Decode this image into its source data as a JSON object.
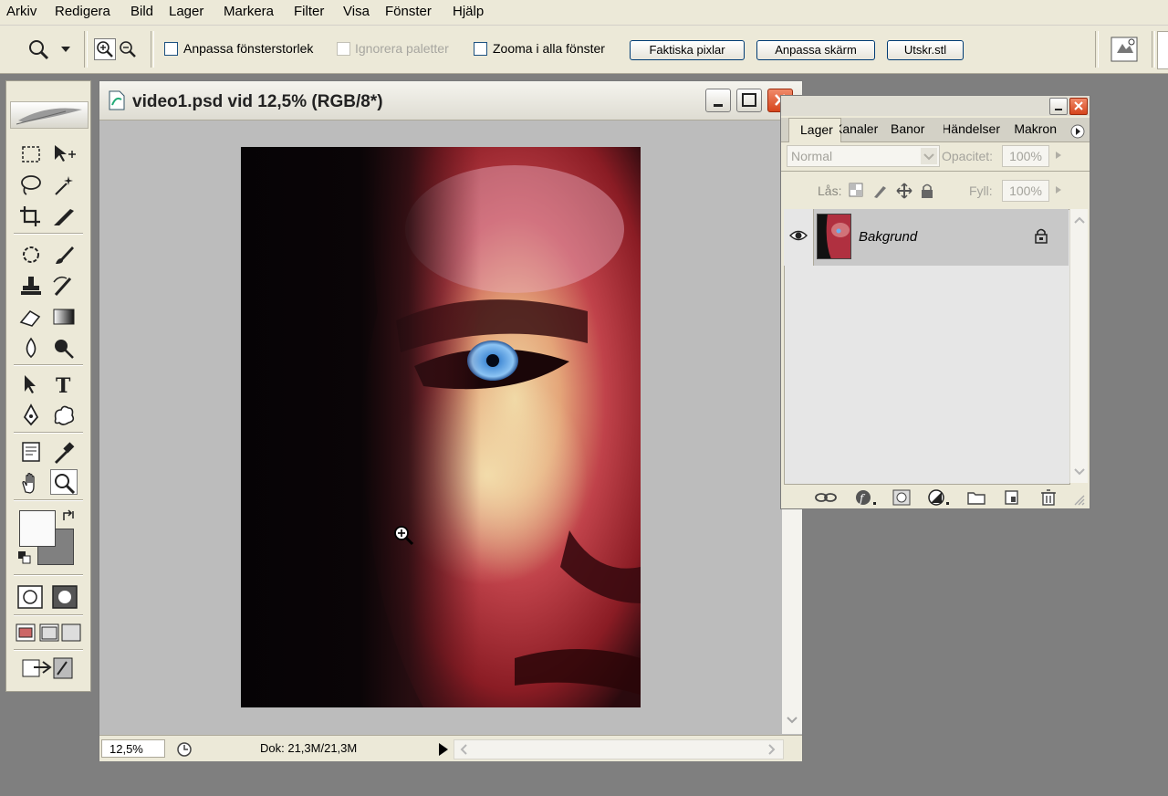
{
  "menu": [
    "Arkiv",
    "Redigera",
    "Bild",
    "Lager",
    "Markera",
    "Filter",
    "Visa",
    "Fönster",
    "Hjälp"
  ],
  "options": {
    "resize_windows_label": "Anpassa fönsterstorlek",
    "ignore_palettes_label": "Ignorera paletter",
    "zoom_all_label": "Zooma i alla fönster",
    "actual_pixels_label": "Faktiska pixlar",
    "fit_screen_label": "Anpassa skärm",
    "print_size_label": "Utskr.stl"
  },
  "document": {
    "title": "video1.psd vid 12,5% (RGB/8*)",
    "zoom": "12,5%",
    "doc_size": "Dok: 21,3M/21,3M"
  },
  "layers_panel": {
    "tabs": [
      "Lager",
      "Kanaler",
      "Banor",
      "Händelser",
      "Makron"
    ],
    "blend_mode": "Normal",
    "opacity_label": "Opacitet:",
    "opacity_value": "100%",
    "lock_label": "Lås:",
    "fill_label": "Fyll:",
    "fill_value": "100%",
    "layers": [
      {
        "name": "Bakgrund",
        "visible": true,
        "locked": true
      }
    ]
  },
  "colors": {
    "ui_bg": "#ece9d8",
    "workspace": "#7f7f7f",
    "close_red": "#e0451f"
  }
}
